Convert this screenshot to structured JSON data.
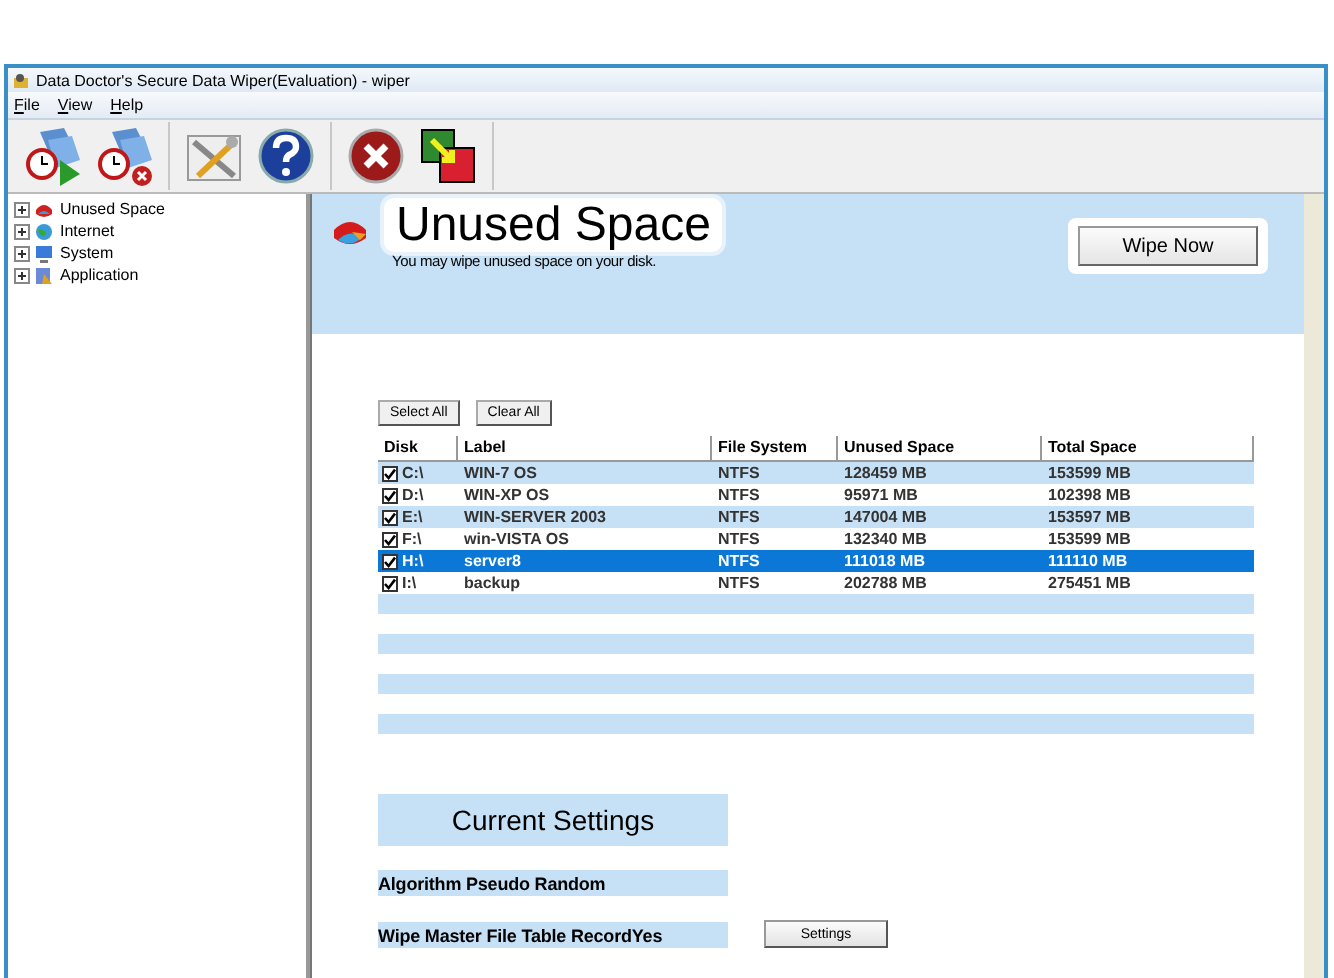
{
  "window": {
    "title": "Data Doctor's Secure Data Wiper(Evaluation) - wiper"
  },
  "menu": [
    {
      "label": "File"
    },
    {
      "label": "View"
    },
    {
      "label": "Help"
    }
  ],
  "toolbar": [
    {
      "kind": "schedule"
    },
    {
      "kind": "unschedule"
    },
    {
      "kind": "tools"
    },
    {
      "kind": "help"
    },
    {
      "kind": "exit"
    },
    {
      "kind": "switch"
    }
  ],
  "tree": [
    {
      "label": "Unused Space",
      "kind": "disk",
      "expanded": false
    },
    {
      "label": "Internet",
      "kind": "globe",
      "expanded": false
    },
    {
      "label": "System",
      "kind": "computer",
      "expanded": false
    },
    {
      "label": "Application",
      "kind": "app",
      "expanded": false
    }
  ],
  "header": {
    "title": "Unused Space",
    "subtitle": "You may wipe unused space on your disk.",
    "button": "Wipe Now"
  },
  "list_buttons": [
    "Select All",
    "Clear All"
  ],
  "table": {
    "columns": [
      "Disk",
      "Label",
      "File System",
      "Unused Space",
      "Total Space"
    ],
    "rows": [
      {
        "cells": [
          "C:\\",
          "WIN-7 OS",
          "NTFS",
          "128459 MB",
          "153599 MB"
        ],
        "checked": true,
        "selected": false
      },
      {
        "cells": [
          "D:\\",
          "WIN-XP OS",
          "NTFS",
          "95971 MB",
          "102398 MB"
        ],
        "checked": true,
        "selected": false
      },
      {
        "cells": [
          "E:\\",
          "WIN-SERVER 2003",
          "NTFS",
          "147004 MB",
          "153597 MB"
        ],
        "checked": true,
        "selected": false
      },
      {
        "cells": [
          "F:\\",
          "win-VISTA OS",
          "NTFS",
          "132340 MB",
          "153599 MB"
        ],
        "checked": true,
        "selected": false
      },
      {
        "cells": [
          "H:\\",
          "server8",
          "NTFS",
          "111018 MB",
          "111110 MB"
        ],
        "checked": true,
        "selected": true
      },
      {
        "cells": [
          "I:\\",
          "backup",
          "NTFS",
          "202788 MB",
          "275451 MB"
        ],
        "checked": true,
        "selected": false
      }
    ]
  },
  "settings": {
    "title": "Current Settings",
    "lines": [
      "Algorithm Pseudo Random",
      "Wipe Master File Table RecordYes"
    ],
    "button": "Settings"
  }
}
